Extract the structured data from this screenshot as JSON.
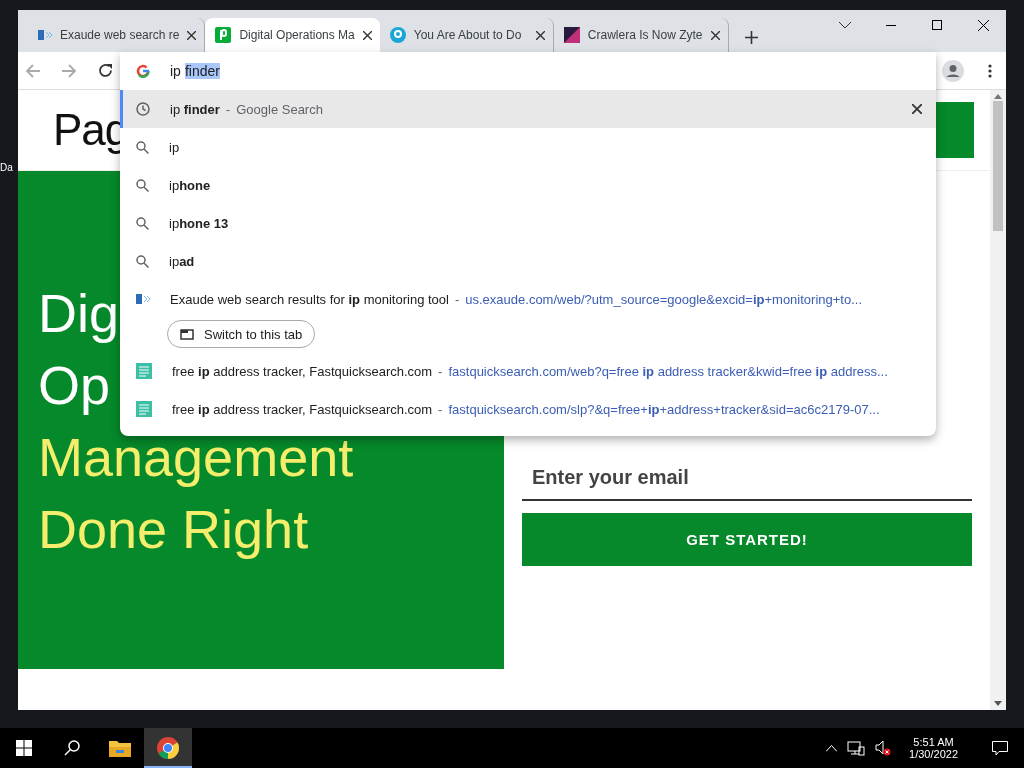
{
  "desktop": {
    "icon_label": "Da"
  },
  "tabs": [
    {
      "title": "Exaude web search re",
      "kind": "exaude",
      "selected": false
    },
    {
      "title": "Digital Operations Ma",
      "kind": "pager",
      "selected": true
    },
    {
      "title": "You Are About to Do",
      "kind": "circle",
      "selected": false
    },
    {
      "title": "Crawlera Is Now Zyte",
      "kind": "crawl",
      "selected": false
    }
  ],
  "omnibox": {
    "typed": "ip",
    "completion": "finder"
  },
  "suggestions": [
    {
      "kind": "history",
      "text": "ip **finder**",
      "separator": "-",
      "description": "Google Search",
      "selected": true
    },
    {
      "kind": "search",
      "text": "ip",
      "selected": false
    },
    {
      "kind": "search",
      "text": "ip**hone**",
      "selected": false
    },
    {
      "kind": "search",
      "text": "ip**hone 13**",
      "selected": false
    },
    {
      "kind": "search",
      "text": "ip**ad**",
      "selected": false
    },
    {
      "kind": "exaude",
      "text": "Exaude web search results for **ip** monitoring tool",
      "separator": "-",
      "url": "us.exaude.com/web/?utm_source=google&excid=**ip**+monitoring+to...",
      "action": "Switch to this tab",
      "selected": false
    },
    {
      "kind": "fastquick",
      "text": "free **ip** address tracker, Fastquicksearch.com",
      "separator": "-",
      "url": "fastquicksearch.com/web?q=free **ip** address tracker&kwid=free **ip** address...",
      "selected": false
    },
    {
      "kind": "fastquick",
      "text": "free **ip** address tracker, Fastquicksearch.com",
      "separator": "-",
      "url": "fastquicksearch.com/slp?&q=free+**ip**+address+tracker&sid=ac6c2179-07...",
      "selected": false
    }
  ],
  "page": {
    "logo": "Pag",
    "hero": [
      {
        "text": "Dig",
        "highlight": false
      },
      {
        "text": "Op",
        "highlight": false
      },
      {
        "text": "Management",
        "highlight": true
      },
      {
        "text": "Done Right",
        "highlight": true
      }
    ],
    "email_placeholder": "Enter your email",
    "cta": "GET STARTED!"
  },
  "taskbar": {
    "time": "5:51 AM",
    "date": "1/30/2022"
  }
}
